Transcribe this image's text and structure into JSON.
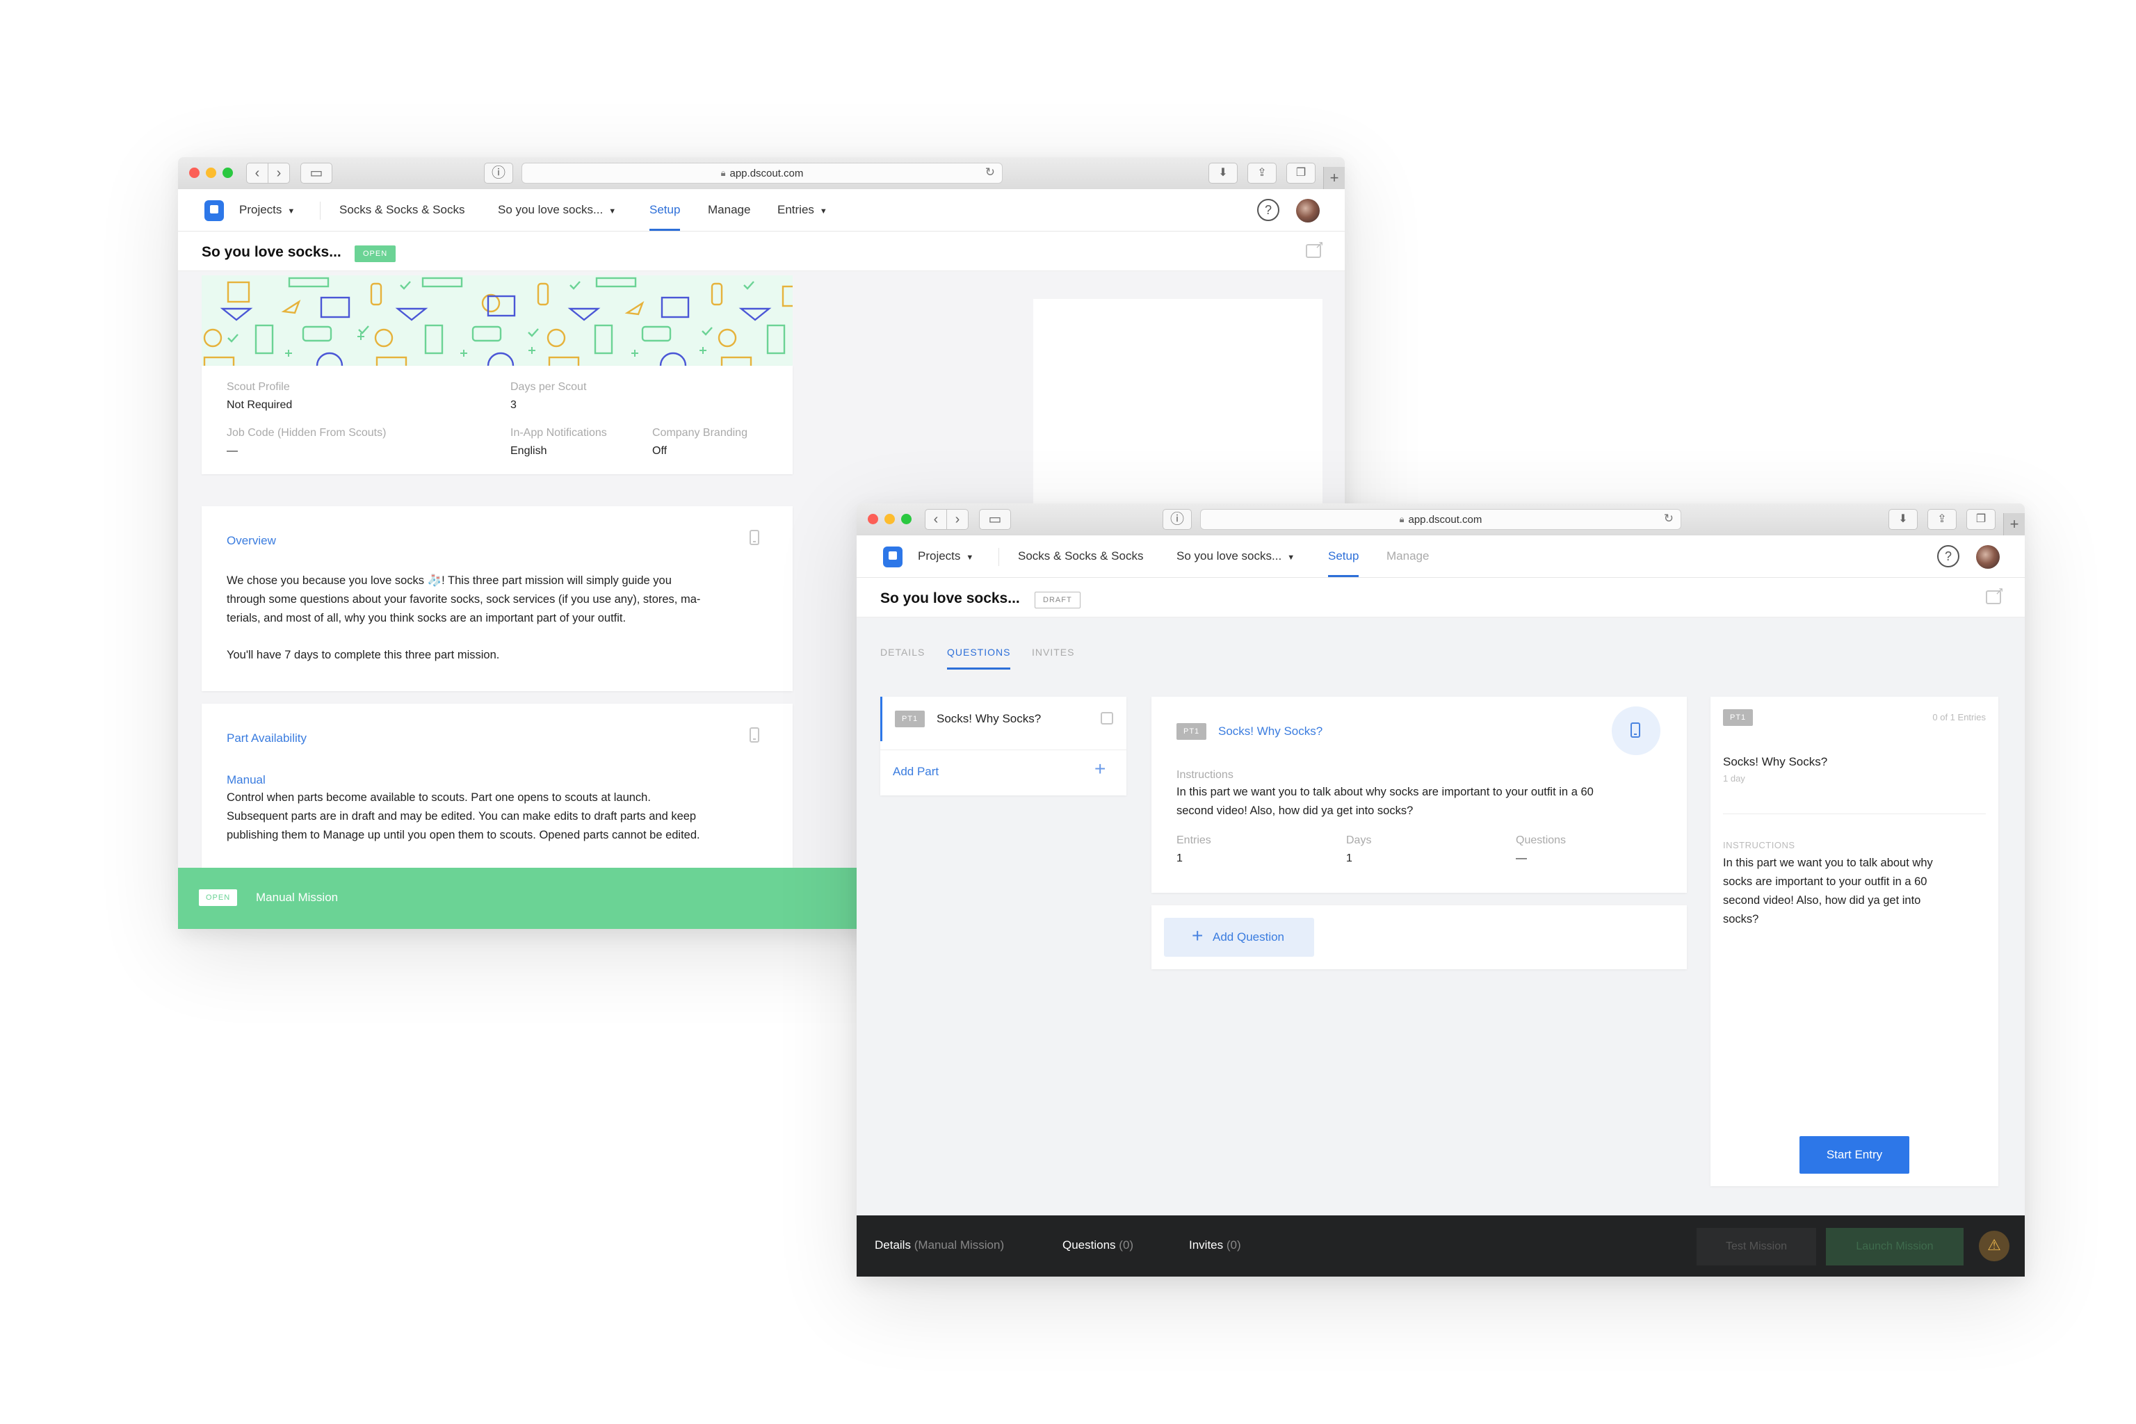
{
  "browser": {
    "url": "app.dscout.com"
  },
  "nav": {
    "projects": "Projects",
    "project_name": "Socks & Socks & Socks",
    "mission_name": "So you love socks...",
    "setup": "Setup",
    "manage": "Manage",
    "entries": "Entries",
    "help": "?"
  },
  "colors": {
    "brand_blue": "#2d77e8",
    "open_green": "#6bd395",
    "footer_dark": "#222324"
  },
  "back_window": {
    "title": "So you love socks...",
    "status": "OPEN",
    "details": {
      "scout_profile_label": "Scout Profile",
      "scout_profile_value": "Not Required",
      "days_label": "Days per Scout",
      "days_value": "3",
      "job_code_label": "Job Code (Hidden From Scouts)",
      "job_code_value": "—",
      "notifications_label": "In-App Notifications",
      "notifications_value": "English",
      "branding_label": "Company Branding",
      "branding_value": "Off"
    },
    "overview": {
      "title": "Overview",
      "line1": "We chose you because you love socks 🧦! This three part mission will simply guide you",
      "line2": "through some questions about your favorite socks, sock services (if you use any), stores, ma-",
      "line3": "terials, and most of all, why you think socks are an important part of your outfit.",
      "line4": "You'll have 7 days to complete this three part mission."
    },
    "availability": {
      "title": "Part Availability",
      "mode": "Manual",
      "line1": "Control when parts become available to scouts. Part one opens to scouts at launch.",
      "line2": "Subsequent parts are in draft and may be edited. You can make edits to draft parts and keep",
      "line3": "publishing them to Manage up until you open them to scouts. Opened parts cannot be edited."
    },
    "mission_bar": {
      "badge": "OPEN",
      "label": "Manual Mission"
    }
  },
  "front_window": {
    "title": "So you love socks...",
    "status": "DRAFT",
    "tabs": [
      "DETAILS",
      "QUESTIONS",
      "INVITES"
    ],
    "part_list": {
      "chip": "PT1",
      "part_name": "Socks! Why Socks?",
      "add_part": "Add Part"
    },
    "part_card": {
      "chip": "PT1",
      "title": "Socks! Why Socks?",
      "instructions_label": "Instructions",
      "instructions_line1": "In this part we want you to talk about why socks are important to your outfit in a 60",
      "instructions_line2": "second video! Also, how did ya get into socks?",
      "entries_label": "Entries",
      "entries_value": "1",
      "days_label": "Days",
      "days_value": "1",
      "questions_label": "Questions",
      "questions_value": "—"
    },
    "add_question": "Add Question",
    "preview": {
      "chip": "PT1",
      "entries_count": "0 of 1 Entries",
      "title": "Socks! Why Socks?",
      "duration": "1 day",
      "instructions_label": "INSTRUCTIONS",
      "line1": "In this part we want you to talk about why",
      "line2": "socks are important to your outfit in a 60",
      "line3": "second video! Also, how did ya get into",
      "line4": "socks?",
      "start_button": "Start Entry"
    },
    "footer": {
      "details_label": "Details",
      "details_sub": "(Manual Mission)",
      "questions_label": "Questions",
      "questions_sub": "(0)",
      "invites_label": "Invites",
      "invites_sub": "(0)",
      "test_mission": "Test Mission",
      "launch_mission": "Launch Mission",
      "warning_icon": "⚠"
    }
  }
}
